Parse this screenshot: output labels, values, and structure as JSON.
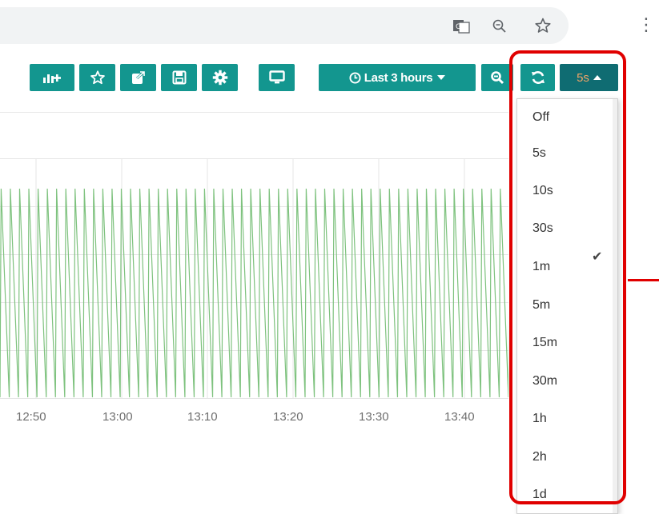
{
  "browser": {
    "icons": [
      "translate-icon",
      "zoom-icon",
      "star-icon",
      "kebab-menu-icon"
    ],
    "menu_glyph": "⋮"
  },
  "toolbar": {
    "buttons": [
      "add-panel-icon",
      "star-icon",
      "share-icon",
      "save-icon",
      "gear-icon",
      "monitor-icon",
      "zoom-out-icon",
      "refresh-icon"
    ],
    "time_range_label": "Last 3 hours",
    "refresh_interval_label": "5s"
  },
  "chart_data": {
    "type": "line",
    "xlabel": "",
    "ylabel": "",
    "x_ticks": [
      "12:50",
      "13:00",
      "13:10",
      "13:20",
      "13:30",
      "13:40"
    ],
    "series": [
      {
        "color": "#7ec27e",
        "pattern": "oscillating",
        "cycles": 55
      }
    ],
    "grid": true
  },
  "refresh_dropdown": {
    "items": [
      "Off",
      "5s",
      "10s",
      "30s",
      "1m",
      "5m",
      "15m",
      "30m",
      "1h",
      "2h",
      "1d"
    ],
    "selected": "5s",
    "check_glyph": "✔"
  },
  "colors": {
    "button": "#13968f",
    "active_button": "#0f6c72",
    "active_text": "#f0a467",
    "series": "#7ec27e",
    "annotation": "#e00000"
  }
}
